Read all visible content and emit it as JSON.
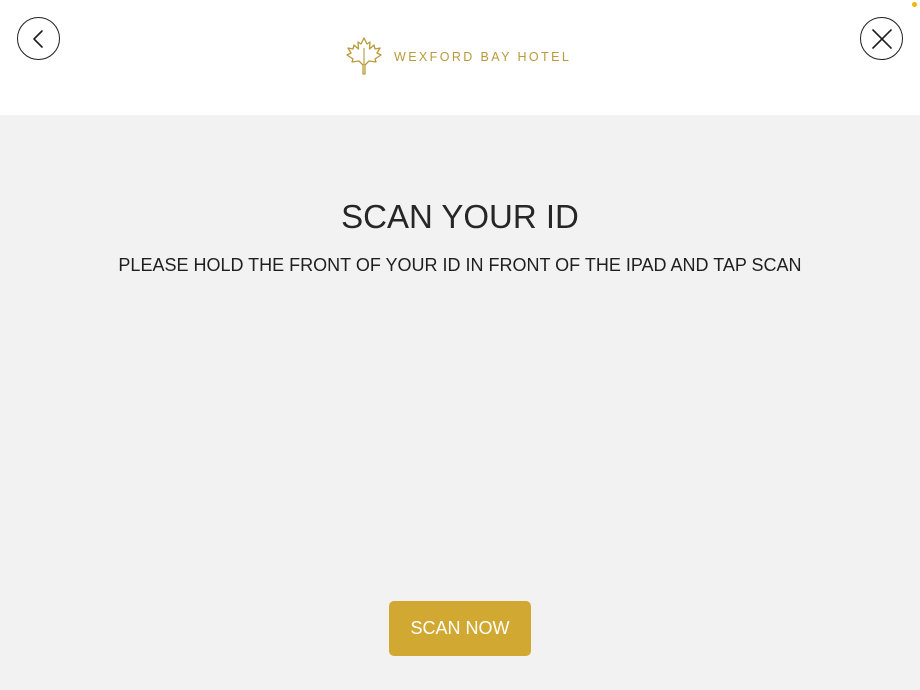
{
  "header": {
    "back_icon": "chevron-left-icon",
    "close_icon": "close-icon",
    "logo": {
      "icon": "maple-leaf-icon",
      "text": "WEXFORD BAY HOTEL",
      "color": "#b89a3a"
    },
    "status_dot_color": "#f2b705"
  },
  "main": {
    "title": "SCAN YOUR ID",
    "instruction": "PLEASE HOLD THE FRONT OF YOUR ID IN FRONT OF THE IPAD AND TAP SCAN",
    "scan_button_label": "SCAN NOW",
    "button_color": "#d1a832",
    "background_color": "#f2f2f2"
  }
}
